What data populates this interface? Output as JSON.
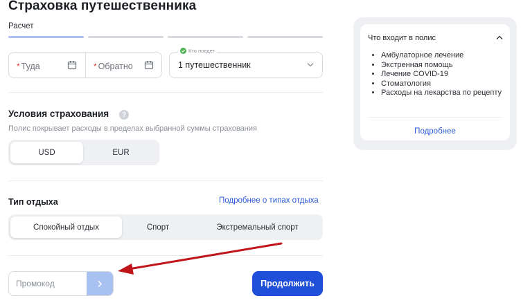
{
  "page": {
    "title": "Страховка путешественника",
    "step_label": "Расчет",
    "steps": [
      {
        "state": "active"
      },
      {
        "state": "inactive"
      },
      {
        "state": "inactive"
      },
      {
        "state": "inactive"
      }
    ]
  },
  "dates": {
    "from_label": "Туда",
    "to_label": "Обратно",
    "required_mark": "*"
  },
  "travelers": {
    "caption": "Кто поедет",
    "value": "1 путешественник"
  },
  "conditions": {
    "title": "Условия страхования",
    "help_glyph": "?",
    "description": "Полис покрывает расходы в пределах выбранной суммы страхования",
    "currencies": [
      {
        "label": "USD",
        "selected": true
      },
      {
        "label": "EUR",
        "selected": false
      }
    ]
  },
  "vacation": {
    "title": "Тип отдыха",
    "more_link": "Подробнее о типах отдыха",
    "options": [
      {
        "label": "Спокойный отдых",
        "selected": true
      },
      {
        "label": "Спорт",
        "selected": false
      },
      {
        "label": "Экстремальный спорт",
        "selected": false
      }
    ]
  },
  "promo": {
    "placeholder": "Промокод",
    "submit_icon": "chevron-right-icon"
  },
  "actions": {
    "continue_label": "Продолжить"
  },
  "policy": {
    "title": "Что входит в полис",
    "toggle_icon": "chevron-up-icon",
    "items": [
      "Амбулаторное лечение",
      "Экстренная помощь",
      "Лечение COVID-19",
      "Стоматология",
      "Расходы на лекарства по рецепту"
    ],
    "more_link": "Подробнее"
  },
  "annotation": {
    "arrow_icon": "red-arrow-icon",
    "color": "#c0161b"
  },
  "colors": {
    "accent": "#1f4fd8",
    "link": "#2b5bd7",
    "step_active": "#a9c1f0",
    "required": "#e2433a",
    "success": "#4caf50"
  }
}
